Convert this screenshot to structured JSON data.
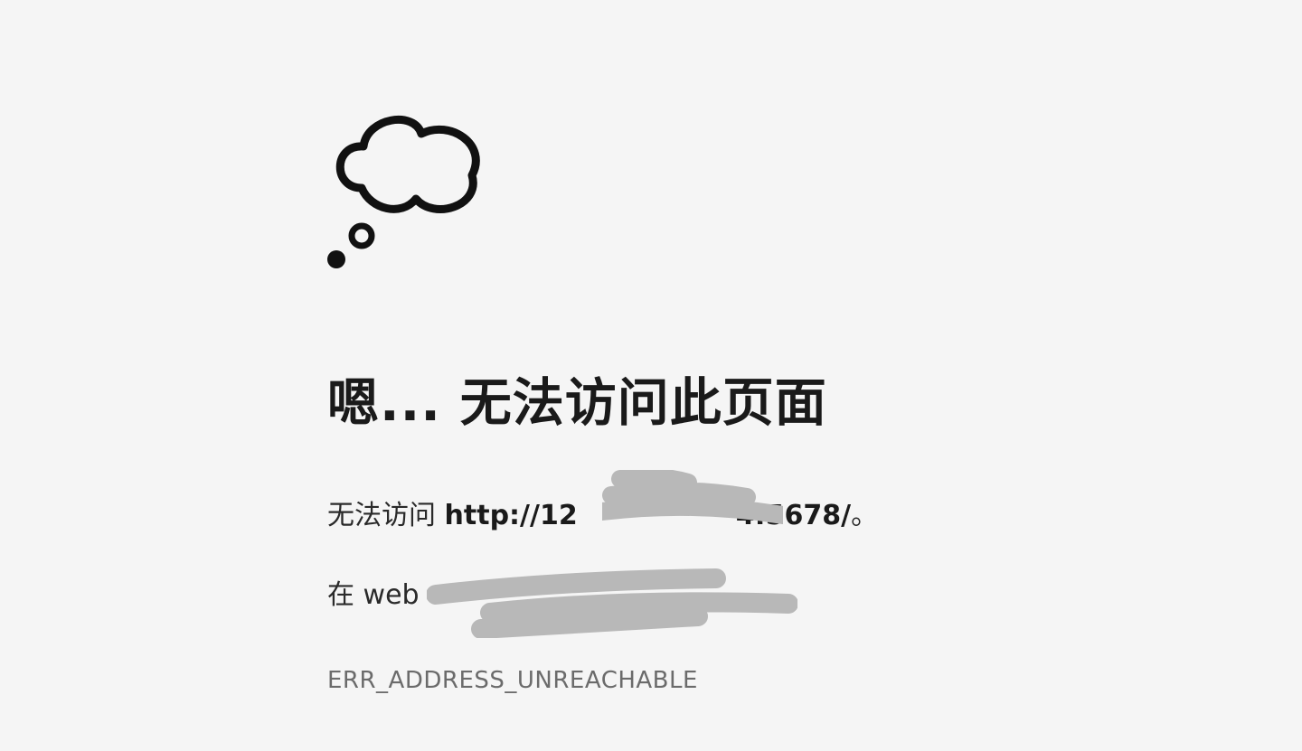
{
  "page": {
    "icon": "thought-cloud-icon",
    "title": "嗯... 无法访问此页面",
    "line1_prefix": "无法访问 ",
    "line1_url": "http://12",
    "line1_url_end": "4:5678/",
    "line1_suffix": "。",
    "line2_prefix": "在 web ",
    "error_code": "ERR_ADDRESS_UNREACHABLE"
  },
  "colors": {
    "background": "#f5f5f5",
    "text": "#1f1f1f",
    "error_code": "#6b6b6b",
    "redaction": "#b8b8b8"
  }
}
